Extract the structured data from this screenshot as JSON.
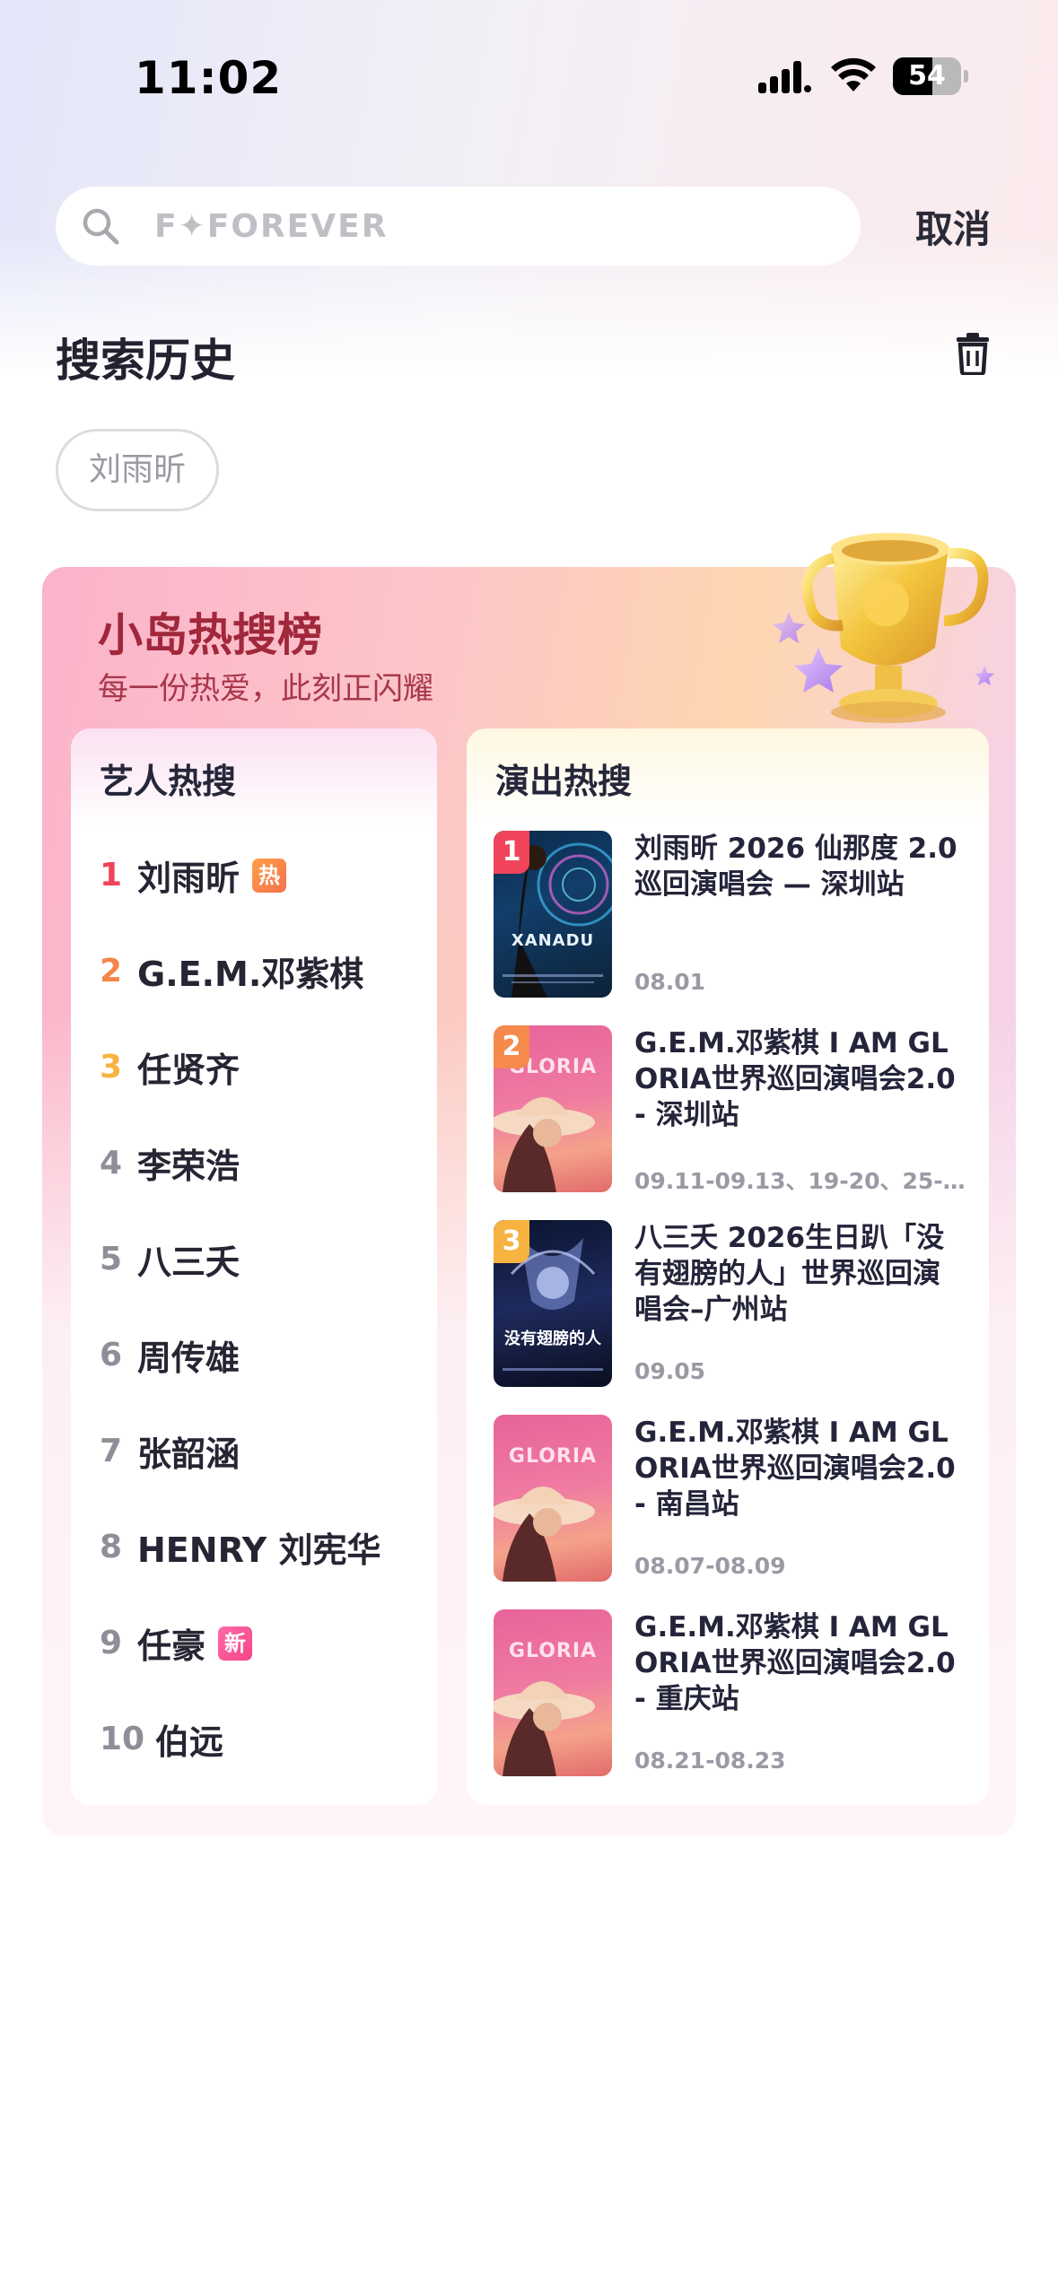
{
  "status_bar": {
    "time": "11:02",
    "battery": "54"
  },
  "search": {
    "placeholder": "F✦FOREVER",
    "cancel_label": "取消"
  },
  "history": {
    "title": "搜索历史",
    "items": [
      "刘雨昕"
    ]
  },
  "hot": {
    "title": "小岛热搜榜",
    "subtitle": "每一份热爱，此刻正闪耀",
    "artists": {
      "title": "艺人热搜",
      "items": [
        {
          "rank": "1",
          "name": "刘雨昕",
          "badge": "热"
        },
        {
          "rank": "2",
          "name": "G.E.M.邓紫棋"
        },
        {
          "rank": "3",
          "name": "任贤齐"
        },
        {
          "rank": "4",
          "name": "李荣浩"
        },
        {
          "rank": "5",
          "name": "八三夭"
        },
        {
          "rank": "6",
          "name": "周传雄"
        },
        {
          "rank": "7",
          "name": "张韶涵"
        },
        {
          "rank": "8",
          "name": "HENRY 刘宪华"
        },
        {
          "rank": "9",
          "name": "任豪",
          "badge": "新"
        },
        {
          "rank": "10",
          "name": "伯远"
        }
      ]
    },
    "shows": {
      "title": "演出热搜",
      "items": [
        {
          "rank": "1",
          "title": "刘雨昕 2026 仙那度 2.0 巡回演唱会 — 深圳站",
          "date": "08.01",
          "poster_text": "XANADU"
        },
        {
          "rank": "2",
          "title": "G.E.M.邓紫棋 I AM GLORIA世界巡回演唱会2.0 - 深圳站",
          "date": "09.11-09.13、19-20、25-...",
          "poster_text": "GLORIA"
        },
        {
          "rank": "3",
          "title": "八三夭 2026生日趴「没有翅膀的人」世界巡回演唱会–广州站",
          "date": "09.05",
          "poster_text": "没有翅膀的人"
        },
        {
          "rank": "",
          "title": "G.E.M.邓紫棋 I AM GLORIA世界巡回演唱会2.0 - 南昌站",
          "date": "08.07-08.09",
          "poster_text": "GLORIA"
        },
        {
          "rank": "",
          "title": "G.E.M.邓紫棋 I AM GLORIA世界巡回演唱会2.0 - 重庆站",
          "date": "08.21-08.23",
          "poster_text": "GLORIA"
        }
      ]
    }
  }
}
